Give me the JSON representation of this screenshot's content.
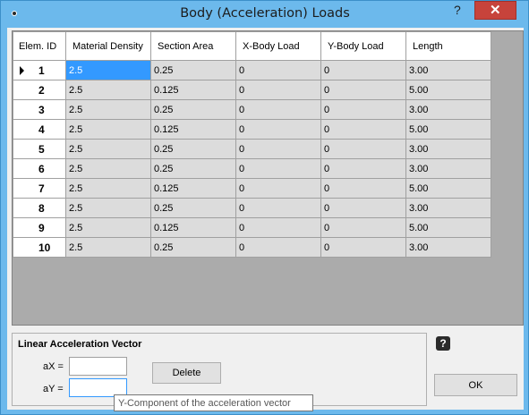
{
  "window": {
    "title": "Body (Acceleration) Loads",
    "help_glyph": "?",
    "close_glyph": "✕"
  },
  "grid": {
    "columns": [
      "Elem. ID",
      "Material Density",
      "Section Area",
      "X-Body Load",
      "Y-Body Load",
      "Length"
    ],
    "rows": [
      {
        "id": "1",
        "density": "2.5",
        "area": "0.25",
        "xload": "0",
        "yload": "0",
        "length": "3.00"
      },
      {
        "id": "2",
        "density": "2.5",
        "area": "0.125",
        "xload": "0",
        "yload": "0",
        "length": "5.00"
      },
      {
        "id": "3",
        "density": "2.5",
        "area": "0.25",
        "xload": "0",
        "yload": "0",
        "length": "3.00"
      },
      {
        "id": "4",
        "density": "2.5",
        "area": "0.125",
        "xload": "0",
        "yload": "0",
        "length": "5.00"
      },
      {
        "id": "5",
        "density": "2.5",
        "area": "0.25",
        "xload": "0",
        "yload": "0",
        "length": "3.00"
      },
      {
        "id": "6",
        "density": "2.5",
        "area": "0.25",
        "xload": "0",
        "yload": "0",
        "length": "3.00"
      },
      {
        "id": "7",
        "density": "2.5",
        "area": "0.125",
        "xload": "0",
        "yload": "0",
        "length": "5.00"
      },
      {
        "id": "8",
        "density": "2.5",
        "area": "0.25",
        "xload": "0",
        "yload": "0",
        "length": "3.00"
      },
      {
        "id": "9",
        "density": "2.5",
        "area": "0.125",
        "xload": "0",
        "yload": "0",
        "length": "5.00"
      },
      {
        "id": "10",
        "density": "2.5",
        "area": "0.25",
        "xload": "0",
        "yload": "0",
        "length": "3.00"
      }
    ]
  },
  "accel": {
    "title": "Linear Acceleration Vector",
    "ax_label": "aX =",
    "ay_label": "aY =",
    "ax_value": "",
    "ay_value": "",
    "delete_label": "Delete"
  },
  "ok_label": "OK",
  "help_icon_glyph": "?",
  "tooltip": "Y-Component of the acceleration vector",
  "colors": {
    "window_frame": "#6cb9ec",
    "close_button": "#c7433b",
    "selection": "#3399ff",
    "cell_background": "#dcdcdc"
  }
}
